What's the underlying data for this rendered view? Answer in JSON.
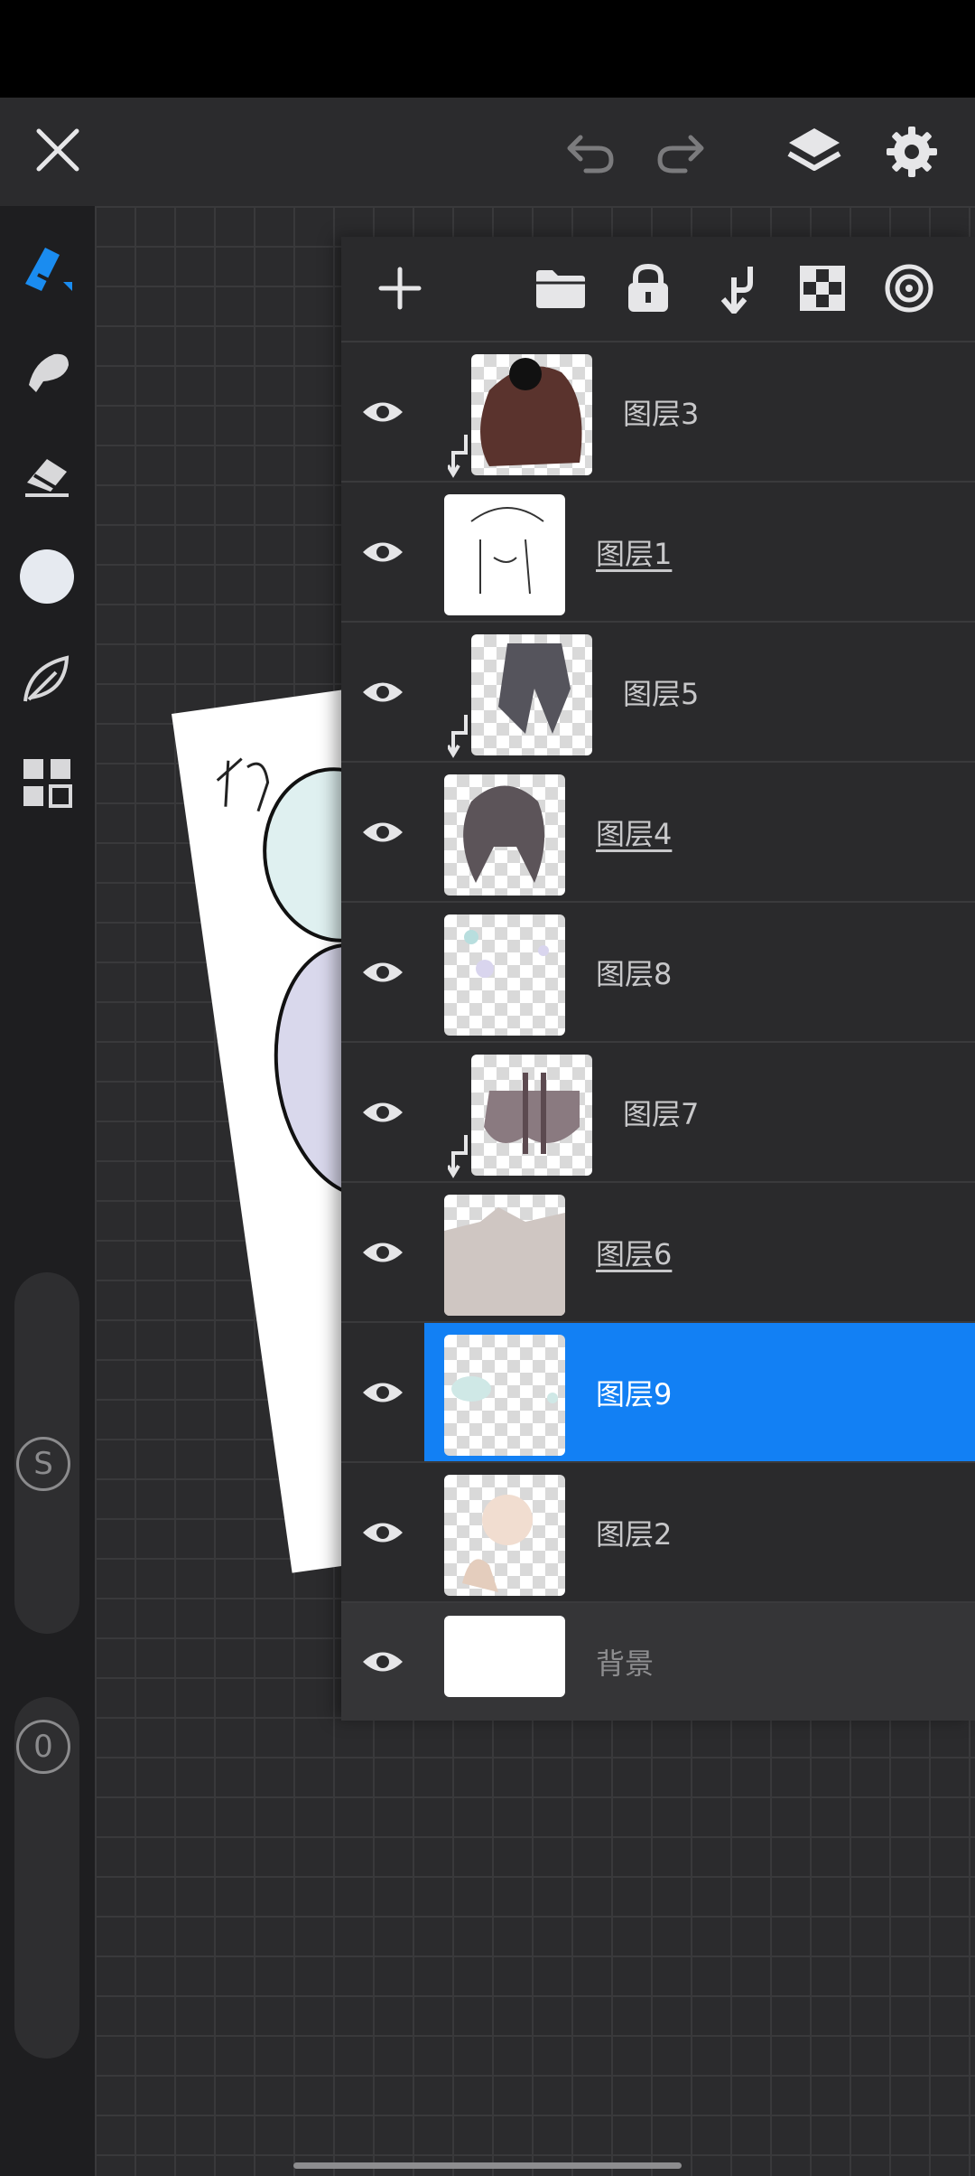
{
  "top_bar": {
    "close_icon": "close-icon",
    "undo_icon": "undo-icon",
    "redo_icon": "redo-icon",
    "layers_icon": "layers-icon",
    "settings_icon": "gear-icon"
  },
  "left_toolbar": {
    "tools": [
      "pencil-icon",
      "smudge-icon",
      "eraser-icon",
      "color-circle-icon",
      "leaf-icon",
      "grid-icon"
    ],
    "size_slider_label": "S",
    "opacity_slider_label": "0"
  },
  "layers_toolbar": {
    "icons": [
      "add-icon",
      "folder-icon",
      "lock-icon",
      "merge-down-icon",
      "transparency-icon",
      "target-icon"
    ]
  },
  "layers": [
    {
      "name": "图层3",
      "clipped": true,
      "underline": false,
      "selected": false
    },
    {
      "name": "图层1",
      "clipped": false,
      "underline": true,
      "selected": false
    },
    {
      "name": "图层5",
      "clipped": true,
      "underline": false,
      "selected": false
    },
    {
      "name": "图层4",
      "clipped": false,
      "underline": true,
      "selected": false
    },
    {
      "name": "图层8",
      "clipped": false,
      "underline": false,
      "selected": false
    },
    {
      "name": "图层7",
      "clipped": true,
      "underline": false,
      "selected": false
    },
    {
      "name": "图层6",
      "clipped": false,
      "underline": true,
      "selected": false
    },
    {
      "name": "图层9",
      "clipped": false,
      "underline": false,
      "selected": true
    },
    {
      "name": "图层2",
      "clipped": false,
      "underline": false,
      "selected": false
    },
    {
      "name": "背景",
      "clipped": false,
      "underline": false,
      "selected": false
    }
  ],
  "colors": {
    "accent": "#1280f4",
    "panel": "#2a2a2c",
    "background": "#232325"
  }
}
